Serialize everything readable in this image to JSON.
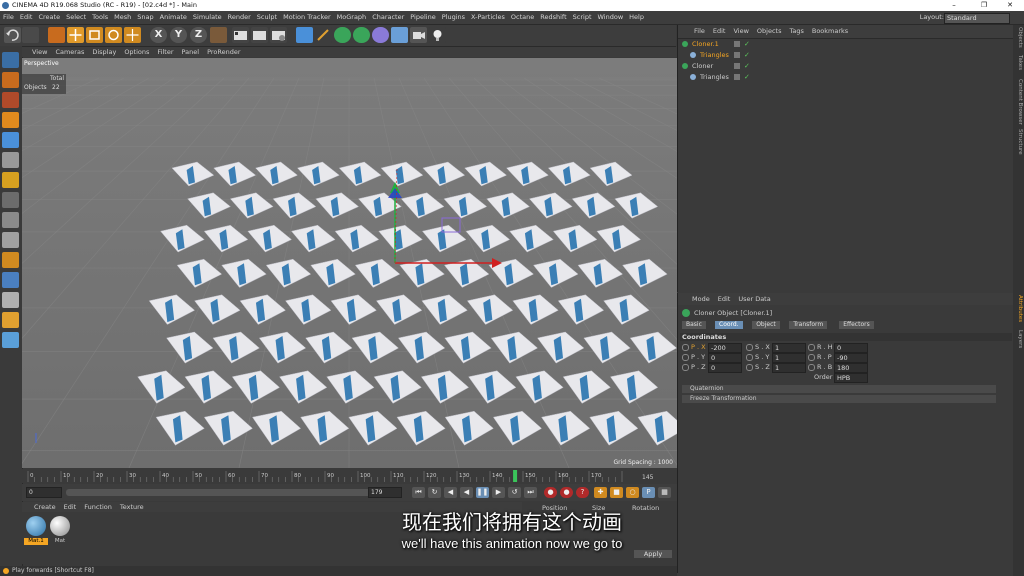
{
  "window": {
    "title": "CINEMA 4D R19.068 Studio (RC - R19) - [02.c4d *] - Main",
    "minimize": "–",
    "restore": "❐",
    "close": "✕"
  },
  "menubar": {
    "items": [
      "File",
      "Edit",
      "Create",
      "Select",
      "Tools",
      "Mesh",
      "Snap",
      "Animate",
      "Simulate",
      "Render",
      "Sculpt",
      "Motion Tracker",
      "MoGraph",
      "Character",
      "Pipeline",
      "Plugins",
      "X-Particles",
      "Octane",
      "Redshift",
      "Script",
      "Window",
      "Help"
    ],
    "layout_label": "Layout:",
    "layout_value": "Standard"
  },
  "toolbar": {
    "axis_x": "X",
    "axis_y": "Y",
    "axis_z": "Z"
  },
  "viewport_menu": [
    "View",
    "Cameras",
    "Display",
    "Options",
    "Filter",
    "Panel",
    "ProRender"
  ],
  "viewport": {
    "name": "Perspective",
    "hud_total": "Total",
    "hud_objects_label": "Objects",
    "hud_objects_value": "22",
    "grid_spacing": "Grid Spacing : 1000"
  },
  "timeline": {
    "ticks": [
      "0",
      "10",
      "20",
      "30",
      "40",
      "50",
      "60",
      "70",
      "80",
      "90",
      "100",
      "110",
      "120",
      "130",
      "140",
      "150",
      "160",
      "170"
    ],
    "current_frame": "145",
    "playhead_fraction": 0.82
  },
  "time_controls": {
    "start": "0",
    "end": "179",
    "min_field": "0 F"
  },
  "material_panel": {
    "menu": [
      "Create",
      "Edit",
      "Function",
      "Texture"
    ],
    "materials": [
      "Mat.1",
      "Mat"
    ],
    "columns": [
      "Position",
      "Size",
      "Rotation"
    ],
    "apply": "Apply"
  },
  "object_manager": {
    "menu": [
      "File",
      "Edit",
      "View",
      "Objects",
      "Tags",
      "Bookmarks"
    ],
    "objects": [
      {
        "name": "Cloner.1",
        "level": 0,
        "selected": true
      },
      {
        "name": "Triangles",
        "level": 1,
        "selected": true
      },
      {
        "name": "Cloner",
        "level": 0,
        "selected": false
      },
      {
        "name": "Triangles",
        "level": 1,
        "selected": false
      }
    ]
  },
  "attribute_manager": {
    "menu": [
      "Mode",
      "Edit",
      "User Data"
    ],
    "object_title": "Cloner Object [Cloner.1]",
    "tabs": [
      {
        "label": "Basic",
        "active": false
      },
      {
        "label": "Coord.",
        "active": true
      },
      {
        "label": "Object",
        "active": false
      },
      {
        "label": "Transform",
        "active": false
      },
      {
        "label": "Effectors",
        "active": false
      }
    ],
    "section": "Coordinates",
    "coords": {
      "px_label": "P . X",
      "px": "-200",
      "py_label": "P . Y",
      "py": "0",
      "pz_label": "P . Z",
      "pz": "0",
      "sx_label": "S . X",
      "sx": "1",
      "sy_label": "S . Y",
      "sy": "1",
      "sz_label": "S . Z",
      "sz": "1",
      "rh_label": "R . H",
      "rh": "0",
      "rp_label": "R . P",
      "rp": "-90",
      "rb_label": "R . B",
      "rb": "180",
      "order_label": "Order",
      "order": "HPB"
    },
    "collapsed_sections": [
      "Quaternion",
      "Freeze Transformation"
    ]
  },
  "right_tabs": [
    "Objects",
    "Takes",
    "Content Browser",
    "Structure",
    "Attributes",
    "Layers"
  ],
  "left_tool_colors": [
    "#3a6ea5",
    "#c86b1e",
    "#b04a2a",
    "#e08a1e",
    "#4a90d9",
    "#999",
    "#d6a020",
    "#6c6c6c",
    "#8a8a8a",
    "#a0a0a0",
    "#d08a20",
    "#4a7fc0",
    "#b0b0b0",
    "#e0a030",
    "#5a9fd8"
  ],
  "status": {
    "text": "Play forwards [Shortcut F8]"
  },
  "subtitles": {
    "zh": "现在我们将拥有这个动画",
    "en": "we'll have this animation now we go to"
  },
  "colors": {
    "accent": "#f5a623",
    "selected_text": "#f5a623",
    "cube_top": "#e8e8ec",
    "cube_blue": "#3b7fb5"
  }
}
